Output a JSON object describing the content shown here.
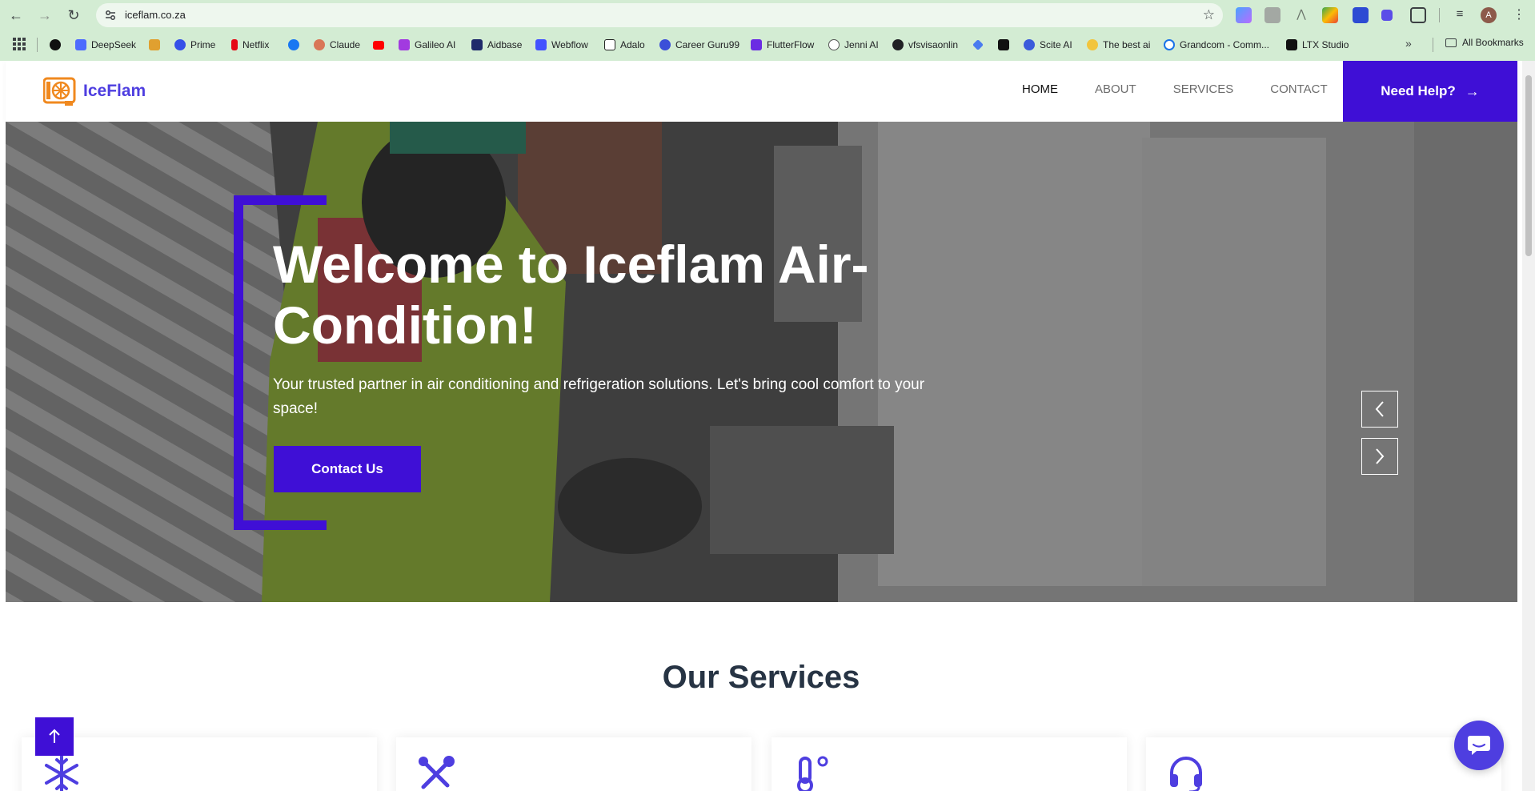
{
  "browser": {
    "url": "iceflam.co.za",
    "back_icon": "arrow-left",
    "forward_icon": "arrow-right",
    "reload_icon": "reload",
    "avatar_letter": "A",
    "bookmarks": [
      {
        "label": "",
        "icon": "threads-icon",
        "color": "#111111"
      },
      {
        "label": "DeepSeek",
        "icon": "deepseek-icon",
        "color": "#4d6bfe"
      },
      {
        "label": "",
        "icon": "hand-icon",
        "color": "#e0a030"
      },
      {
        "label": "Prime",
        "icon": "prime-icon",
        "color": "#3550e8"
      },
      {
        "label": "Netflix",
        "icon": "netflix-icon",
        "color": "#e50914"
      },
      {
        "label": "",
        "icon": "facebook-icon",
        "color": "#1877f2"
      },
      {
        "label": "Claude",
        "icon": "claude-icon",
        "color": "#d97757"
      },
      {
        "label": "",
        "icon": "youtube-icon",
        "color": "#ff0000"
      },
      {
        "label": "Galileo AI",
        "icon": "galileo-icon",
        "color": "#a23ae0"
      },
      {
        "label": "Aidbase",
        "icon": "aidbase-icon",
        "color": "#1f2a6b"
      },
      {
        "label": "Webflow",
        "icon": "webflow-icon",
        "color": "#4353ff"
      },
      {
        "label": "Adalo",
        "icon": "adalo-icon",
        "color": "#222222"
      },
      {
        "label": "Career Guru99",
        "icon": "careerguru-icon",
        "color": "#3b4fd8"
      },
      {
        "label": "FlutterFlow",
        "icon": "flutterflow-icon",
        "color": "#6b2de3"
      },
      {
        "label": "Jenni AI",
        "icon": "jenni-icon",
        "color": "#555555"
      },
      {
        "label": "vfsvisaonlin",
        "icon": "globe-icon",
        "color": "#202124"
      },
      {
        "label": "",
        "icon": "gemini-icon",
        "color": "#4a7bf0"
      },
      {
        "label": "",
        "icon": "aws-icon",
        "color": "#111111"
      },
      {
        "label": "Scite AI",
        "icon": "scite-icon",
        "color": "#3b5bdb"
      },
      {
        "label": "The best ai",
        "icon": "sun-icon",
        "color": "#f2c53d"
      },
      {
        "label": "Grandcom - Comm...",
        "icon": "chat-bubble-icon",
        "color": "#1a73e8"
      },
      {
        "label": "LTX Studio",
        "icon": "ltx-icon",
        "color": "#111111"
      }
    ],
    "all_bookmarks": "All Bookmarks"
  },
  "site": {
    "brand": "IceFlam",
    "brand_color": "#4e3ee0",
    "accent_color": "#3f0fd6",
    "nav": [
      {
        "label": "HOME",
        "active": true
      },
      {
        "label": "ABOUT",
        "active": false
      },
      {
        "label": "SERVICES",
        "active": false
      },
      {
        "label": "CONTACT",
        "active": false
      }
    ],
    "help_button": "Need Help?",
    "hero": {
      "title": "Welcome to Iceflam Air-Condition!",
      "subtitle": "Your trusted partner in air conditioning and refrigeration solutions. Let's bring cool comfort to your space!",
      "cta": "Contact Us",
      "prev_icon": "chevron-left",
      "next_icon": "chevron-right"
    },
    "services_title": "Our Services",
    "service_icons": [
      "snowflake-icon",
      "tools-icon",
      "thermometer-icon",
      "headset-icon"
    ],
    "back_to_top_icon": "arrow-up",
    "chat_icon": "chat-bubble"
  }
}
